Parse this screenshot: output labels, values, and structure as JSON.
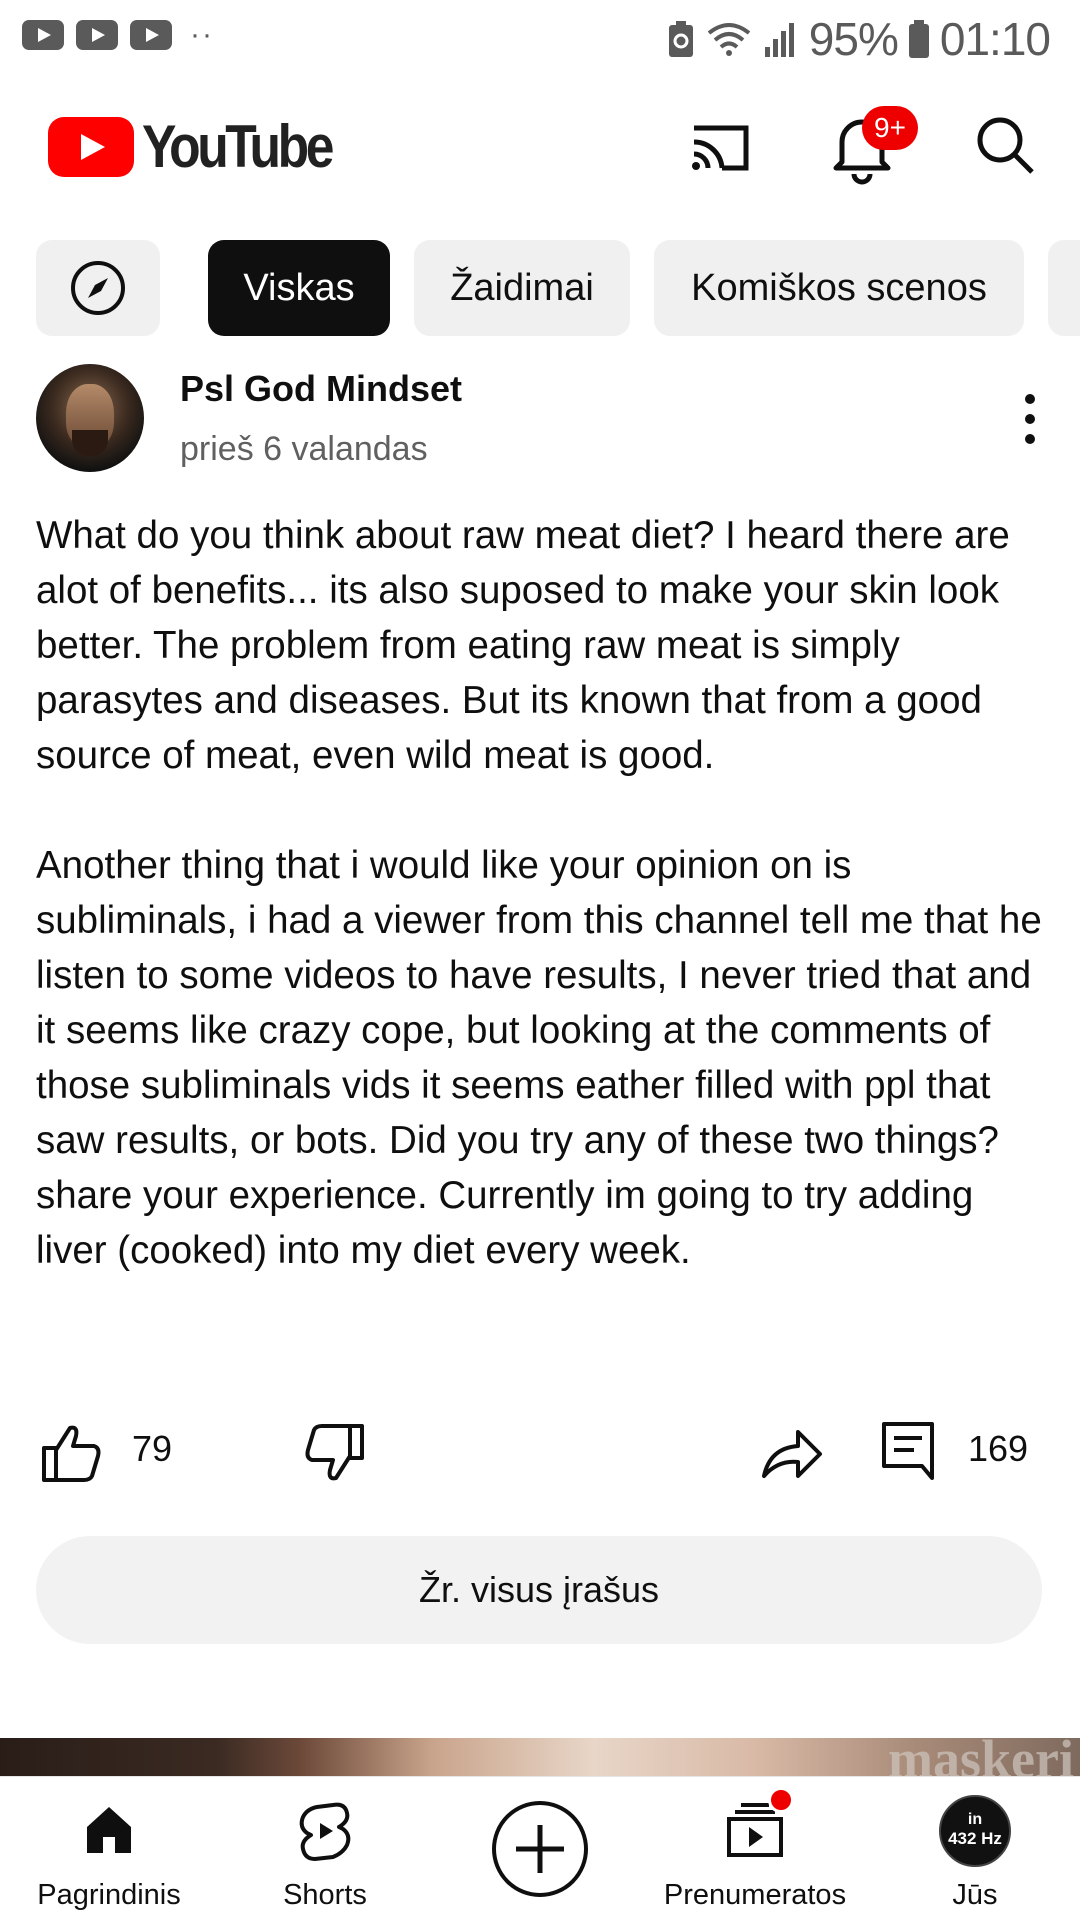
{
  "status_bar": {
    "battery": "95%",
    "time": "01:10"
  },
  "app_bar": {
    "logo_text": "YouTube",
    "notification_badge": "9+"
  },
  "chips": [
    {
      "label": "Viskas",
      "active": true
    },
    {
      "label": "Žaidimai",
      "active": false
    },
    {
      "label": "Komiškos scenos",
      "active": false
    }
  ],
  "post": {
    "channel": "Psl God Mindset",
    "time": "prieš 6 valandas",
    "paragraph1": "What do you think about raw meat diet? I heard there are alot of benefits... its also suposed to make your skin look better. The problem from eating raw meat is simply parasytes and diseases. But its known that from a good source of meat, even wild meat is good.",
    "paragraph2": "Another thing that i would like your opinion on is subliminals, i had a viewer from this channel tell me that he listen to some videos to have results, I never tried that and it seems like crazy cope, but looking at the comments of those subliminals vids it seems eather filled with ppl that saw results, or bots. Did you try any of these two things? share your experience. Currently im going to try adding liver (cooked) into my diet every week.",
    "likes": "79",
    "comments": "169",
    "see_all_label": "Žr. visus įrašus"
  },
  "thumbnail_peek_text": "maskeri",
  "bottom_nav": {
    "home": "Pagrindinis",
    "shorts": "Shorts",
    "subscriptions": "Prenumeratos",
    "you": "Jūs",
    "you_avatar_line1": "in",
    "you_avatar_line2": "432 Hz"
  },
  "colors": {
    "brand_red": "#ff0000",
    "chip_active": "#0f0f0f",
    "chip_inactive": "#f0f0f0"
  }
}
